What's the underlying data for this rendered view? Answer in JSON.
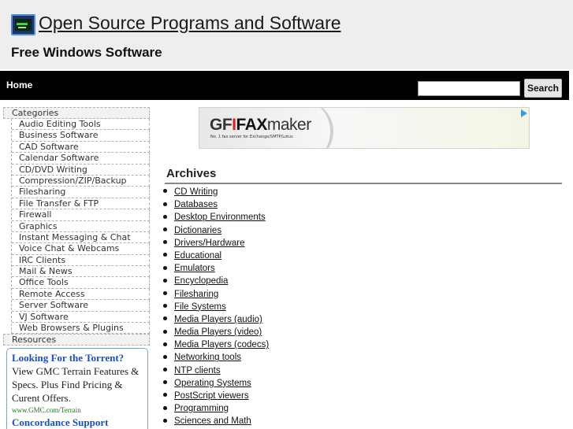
{
  "header": {
    "title": "Open Source Programs and Software",
    "tagline": "Free Windows Software"
  },
  "nav": {
    "home_label": "Home",
    "search_placeholder": "",
    "search_button": "Search"
  },
  "sidebar": {
    "categories_label": "Categories",
    "items": [
      {
        "label": "Audio Editing Tools"
      },
      {
        "label": "Business Software"
      },
      {
        "label": "CAD Software"
      },
      {
        "label": "Calendar Software"
      },
      {
        "label": "CD/DVD Writing"
      },
      {
        "label": "Compression/ZIP/Backup"
      },
      {
        "label": "Filesharing"
      },
      {
        "label": "File Transfer & FTP"
      },
      {
        "label": "Firewall"
      },
      {
        "label": "Graphics"
      },
      {
        "label": "Instant Messaging & Chat"
      },
      {
        "label": "Voice Chat & Webcams"
      },
      {
        "label": "IRC Clients"
      },
      {
        "label": "Mail & News"
      },
      {
        "label": "Office Tools"
      },
      {
        "label": "Remote Access"
      },
      {
        "label": "Server Software"
      },
      {
        "label": "VJ Software"
      },
      {
        "label": "Web Browsers & Plugins"
      }
    ],
    "resources_label": "Resources"
  },
  "ad": {
    "title1": "Looking For the Torrent?",
    "text1": "View GMC Terrain Features & Specs. Plus Find Pricing & Curent Offers.",
    "url1": "www.GMC.com/Terrain",
    "title2": "Concordance Support"
  },
  "banner": {
    "logo_gf": "GF",
    "logo_i": "I",
    "logo_fax": "FAX",
    "logo_maker": "maker",
    "subtitle": "No. 1 fax server for Exchange/SMTP/Lotus"
  },
  "archives": {
    "title": "Archives",
    "items": [
      {
        "label": "CD Writing"
      },
      {
        "label": "Databases"
      },
      {
        "label": "Desktop Environments"
      },
      {
        "label": "Dictionaries"
      },
      {
        "label": "Drivers/Hardware"
      },
      {
        "label": "Educational"
      },
      {
        "label": "Emulators"
      },
      {
        "label": "Encyclopedia"
      },
      {
        "label": "Filesharing"
      },
      {
        "label": "File Systems"
      },
      {
        "label": "Media Players (audio)"
      },
      {
        "label": "Media Players (video)"
      },
      {
        "label": "Media Players (codecs)"
      },
      {
        "label": "Networking tools"
      },
      {
        "label": "NTP clients"
      },
      {
        "label": "Operating Systems"
      },
      {
        "label": "PostScript viewers"
      },
      {
        "label": "Programming"
      },
      {
        "label": "Sciences and Math"
      }
    ]
  }
}
